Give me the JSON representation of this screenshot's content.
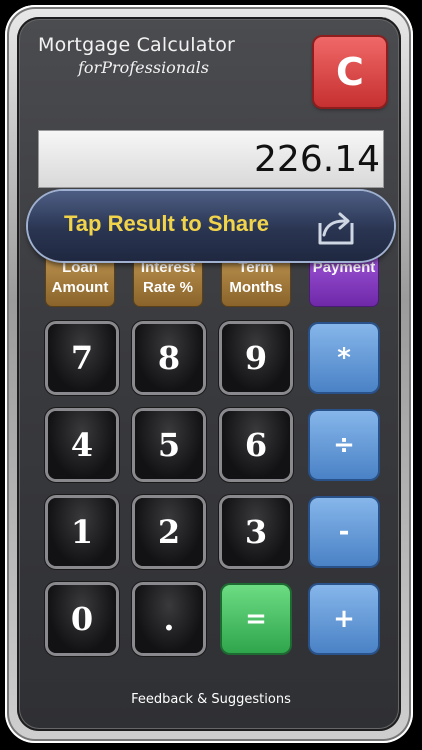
{
  "app": {
    "title_line1": "Mortgage Calculator",
    "title_line2": "forProfessionals",
    "clear_label": "C"
  },
  "display": {
    "value": "226.14"
  },
  "share": {
    "label": "Tap Result to Share",
    "icon": "share-icon"
  },
  "functions": [
    {
      "line1": "Loan",
      "line2": "Amount"
    },
    {
      "line1": "Interest",
      "line2": "Rate %"
    },
    {
      "line1": "Term",
      "line2": "Months"
    },
    {
      "line1": "Payment",
      "line2": ""
    }
  ],
  "keypad": {
    "k7": "7",
    "k8": "8",
    "k9": "9",
    "mul": "*",
    "k4": "4",
    "k5": "5",
    "k6": "6",
    "div": "÷",
    "k1": "1",
    "k2": "2",
    "k3": "3",
    "sub": "-",
    "k0": "0",
    "dot": ".",
    "eq": "=",
    "add": "+"
  },
  "footer": {
    "label": "Feedback  & Suggestions"
  },
  "colors": {
    "clear": "#d63b3b",
    "function_brown": "#a87c3f",
    "payment_purple": "#8a3dc4",
    "operator_blue": "#5f95d8",
    "equals_green": "#45c064",
    "share_text": "#f2d44a"
  }
}
